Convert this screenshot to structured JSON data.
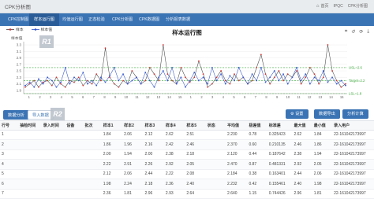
{
  "app": {
    "title": "CPK分析图",
    "top_links": [
      {
        "icon": "home-icon",
        "label": "首页"
      },
      {
        "label": "IPQC"
      },
      {
        "label": "CPK分析图"
      }
    ]
  },
  "tabs": [
    {
      "label": "CPK控制图",
      "active": false
    },
    {
      "label": "样本运行图",
      "active": true
    },
    {
      "label": "均值运行图",
      "active": false
    },
    {
      "label": "正态检验",
      "active": false
    },
    {
      "label": "CPK分析图",
      "active": false
    },
    {
      "label": "CPK数据图",
      "active": false
    },
    {
      "label": "分析报表数据",
      "active": false
    }
  ],
  "legend": {
    "series1": "样本",
    "series2": "样本值"
  },
  "watermarks": {
    "chart": "R1",
    "toolbar": "R2"
  },
  "chart_tools": [
    "crop-icon",
    "restore-icon",
    "refresh-icon",
    "download-icon"
  ],
  "chart_data": {
    "type": "line",
    "title": "样本运行图",
    "ylabel": "样本值",
    "ylim": [
      1.8,
      3.3
    ],
    "yticks": [
      "3.3",
      "3.1",
      "2.9",
      "2.7",
      "2.5",
      "2.3",
      "2.1",
      "1.9"
    ],
    "xticks": [
      "1",
      "2",
      "3",
      "4",
      "5",
      "6",
      "7",
      "8",
      "9",
      "10",
      "11",
      "12",
      "13",
      "14",
      "15",
      "1",
      "2",
      "3",
      "4",
      "5",
      "6",
      "7",
      "8",
      "9",
      "10",
      "11",
      "12",
      "13",
      "14",
      "15"
    ],
    "reference_lines": [
      {
        "label": "USL=2.6",
        "value": 2.6,
        "color": "#3aa53a"
      },
      {
        "label": "Target=2.2",
        "value": 2.2,
        "color": "#3aa53a"
      },
      {
        "label": "LSL=1.8",
        "value": 1.8,
        "color": "#3aa53a"
      }
    ],
    "series": [
      {
        "name": "样本",
        "color": "#444444",
        "marker": "#d63333",
        "values": [
          2.0,
          2.1,
          2.2,
          2.0,
          2.15,
          2.2,
          2.05,
          2.3,
          2.1,
          2.0,
          2.2,
          2.15,
          2.3,
          2.05,
          2.2,
          2.1,
          2.4,
          2.2,
          3.2,
          2.3,
          2.1,
          2.0,
          2.2,
          2.1,
          2.5,
          2.3,
          2.1,
          2.2,
          2.6,
          2.4,
          2.2,
          3.3,
          2.4,
          2.2,
          2.1,
          2.6,
          2.3,
          2.15,
          2.3,
          2.8,
          2.4,
          2.0,
          2.1,
          2.3,
          2.5,
          2.2,
          2.1,
          2.4,
          2.2,
          2.3,
          2.1,
          2.2,
          2.6,
          3.0,
          2.4,
          2.1,
          2.3,
          2.5,
          2.2,
          2.4,
          2.3,
          2.5,
          2.1,
          2.3,
          2.6,
          2.4,
          2.1,
          2.3,
          3.3,
          2.5,
          2.2,
          2.0,
          2.1
        ]
      },
      {
        "name": "样本值",
        "color": "#3355cc",
        "marker": "#3355cc",
        "values": [
          2.05,
          2.15,
          2.0,
          2.25,
          2.1,
          2.3,
          2.2,
          2.0,
          2.15,
          2.6,
          2.1,
          2.3,
          2.2,
          2.45,
          2.1,
          2.2,
          2.05,
          2.3,
          2.15,
          2.35,
          2.6,
          2.2,
          2.4,
          2.1,
          2.2,
          2.3,
          2.1,
          2.45,
          2.2,
          2.0,
          2.3,
          2.5,
          2.2,
          2.6,
          2.1,
          2.3,
          2.0,
          2.2,
          2.45,
          2.2,
          2.3,
          2.1,
          2.6,
          2.2,
          2.4,
          2.1,
          2.35,
          2.2,
          2.6,
          2.3,
          2.1,
          2.4,
          2.2,
          2.6,
          2.15,
          2.3,
          2.5,
          2.2,
          2.4,
          2.1,
          2.3,
          2.6,
          2.2,
          2.4,
          2.1,
          2.3,
          2.2,
          2.5,
          2.15,
          2.3,
          2.1,
          2.2,
          2.05
        ]
      }
    ]
  },
  "toolbar": {
    "tab_left": "数据分析",
    "tab_right": "导入数据",
    "settings_label": "设置",
    "export_label": "数据导出",
    "analyze_label": "分析计算"
  },
  "table": {
    "columns": [
      "行号",
      "抽检时间",
      "录入时间",
      "设备",
      "批次",
      "样本1",
      "样本2",
      "样本3",
      "样本4",
      "样本5",
      "状态",
      "平均值",
      "极差值",
      "标准差",
      "最大值",
      "最小值",
      "录入用户"
    ],
    "rows": [
      [
        "1",
        "",
        "",
        "",
        "",
        "1.84",
        "2.06",
        "2.12",
        "2.62",
        "2.51",
        "",
        "2.230",
        "0.78",
        "0.325423",
        "2.62",
        "1.84",
        "22-161042173997"
      ],
      [
        "2",
        "",
        "",
        "",
        "",
        "1.86",
        "1.96",
        "2.16",
        "2.42",
        "2.46",
        "",
        "2.370",
        "0.60",
        "0.210135",
        "2.46",
        "1.86",
        "22-161042173997"
      ],
      [
        "3",
        "",
        "",
        "",
        "",
        "2.00",
        "1.94",
        "2.00",
        "2.38",
        "2.18",
        "",
        "2.120",
        "0.44",
        "0.187642",
        "2.38",
        "1.94",
        "22-161042173997"
      ],
      [
        "4",
        "",
        "",
        "",
        "",
        "2.22",
        "2.91",
        "2.26",
        "2.92",
        "2.05",
        "",
        "2.470",
        "0.87",
        "0.481331",
        "2.92",
        "2.05",
        "22-161042173997"
      ],
      [
        "5",
        "",
        "",
        "",
        "",
        "2.12",
        "2.06",
        "2.44",
        "2.22",
        "2.08",
        "",
        "2.184",
        "0.38",
        "0.163401",
        "2.44",
        "2.06",
        "22-161042173997"
      ],
      [
        "6",
        "",
        "",
        "",
        "",
        "1.98",
        "2.24",
        "2.18",
        "2.36",
        "2.40",
        "",
        "2.232",
        "0.42",
        "0.155461",
        "2.40",
        "1.98",
        "22-161042173997"
      ],
      [
        "7",
        "",
        "",
        "",
        "",
        "2.36",
        "1.81",
        "2.96",
        "2.93",
        "2.64",
        "",
        "2.640",
        "1.15",
        "0.744426",
        "2.96",
        "1.81",
        "22-161042173997"
      ]
    ]
  }
}
